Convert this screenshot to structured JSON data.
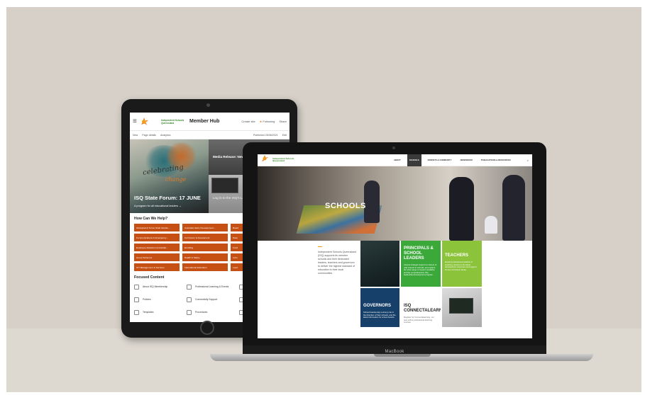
{
  "tablet": {
    "header": {
      "logo_text": "Independent Schools Queensland",
      "title": "Member Hub",
      "actions": [
        "Create site",
        "Following",
        "Share"
      ]
    },
    "subbar": {
      "left": [
        "New",
        "Page details",
        "Analytics"
      ],
      "right": [
        "Published 25/06/2021",
        "Edit"
      ]
    },
    "hero": {
      "script_word1": "celebrating",
      "script_word2": "change",
      "title": "ISQ State Forum: 17 JUNE",
      "subtitle": "A program for all educational leaders →",
      "side_top": "Media Release: New CEO appointed to...",
      "side_bottom": "Log in to the ISQ's LAP Verification Portal"
    },
    "help": {
      "heading": "How Can We Help?",
      "buttons": [
        "Aboriginal & Torres Strait Islande...",
        "Australian Early Development...",
        "Board",
        "Communications & Emergency...",
        "Curriculum & Assessment",
        "Data",
        "Employee Relations (Industrial...",
        "Enrolling",
        "Fund",
        "Group Schemes",
        "Health & Safety",
        "Inclu",
        "ICT Management & Services",
        "International Education",
        "Lead"
      ]
    },
    "focused": {
      "heading": "Focused Content",
      "items": [
        "About ISQ Membership",
        "Professional Learning & Events",
        "",
        "Policies",
        "Connectivity Support",
        "",
        "Templates",
        "Procedures",
        ""
      ]
    }
  },
  "laptop": {
    "brand": "MacBook",
    "nav": {
      "logo_text": "Independent Schools Queensland",
      "items": [
        "ABOUT",
        "SCHOOLS",
        "PARENTS & COMMUNITY",
        "NEWSROOM",
        "PUBLICATIONS & RESOURCES"
      ],
      "active": "SCHOOLS"
    },
    "hero_title": "SCHOOLS",
    "intro": "Independent Schools Queensland (ISQ) supports its member schools and their dedicated leaders, teachers and governors to deliver the highest standard of education to their local communities.",
    "tiles": [
      {
        "title": "",
        "text": ""
      },
      {
        "title": "PRINCIPALS & SCHOOL LEADERS",
        "text": "Access strategic support on issues of vital interest to schools, and explore the wide range of support available, and the comprehensive ISQ leadership development program."
      },
      {
        "title": "TEACHERS",
        "text": "Expand professional practice in teaching, access to the latest development resources and support for key curriculum areas."
      },
      {
        "title": "GOVERNORS",
        "text": "School boards play a strong role in the direction of their schools, and the latest information for school boards."
      },
      {
        "title": "ISQ CONNECTALEARN",
        "text": "Register for Connectalearning, our new online professional learning courses"
      },
      {
        "title": "",
        "text": ""
      }
    ]
  }
}
